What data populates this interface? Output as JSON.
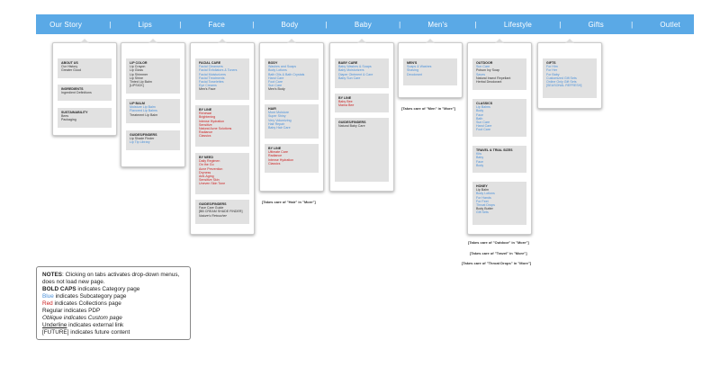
{
  "nav": [
    "Our Story",
    "Lips",
    "Face",
    "Body",
    "Baby",
    "Men's",
    "Lifestyle",
    "Gifts",
    "Outlet"
  ],
  "separator": "|",
  "columns": {
    "our_story": {
      "boxes": [
        {
          "title": "ABOUT US",
          "lines": [
            {
              "t": "Our History",
              "s": "plain"
            },
            {
              "t": "Greater Good",
              "s": "plain"
            }
          ]
        },
        {
          "title": "INGREDIENTS",
          "lines": [
            {
              "t": "Ingredient Definitions",
              "s": "plain"
            }
          ]
        },
        {
          "title": "SUSTAINABILITY",
          "lines": [
            {
              "t": "Bees",
              "s": "plain"
            },
            {
              "t": "Packaging",
              "s": "plain"
            }
          ]
        }
      ]
    },
    "lips": {
      "boxes": [
        {
          "title": "LIP COLOR",
          "lines": [
            {
              "t": "Lip Crayon",
              "s": "plain"
            },
            {
              "t": "Lip Gloss",
              "s": "plain"
            },
            {
              "t": "Lip Shimmer",
              "s": "plain"
            },
            {
              "t": "Lip Shine",
              "s": "plain"
            },
            {
              "t": "Tinted Lip Balm",
              "s": "plain"
            },
            {
              "t": "[LIPSICK]",
              "s": "plain"
            }
          ]
        },
        {
          "title": "LIP BALM",
          "lines": [
            {
              "t": "Moisture Lip Balm",
              "s": "sub"
            },
            {
              "t": "Flavored Lip Balms",
              "s": "sub"
            },
            {
              "t": "Treatment Lip Balm",
              "s": "plain"
            }
          ]
        },
        {
          "title": "GUIDES/FINDERS",
          "lines": [
            {
              "t": "Lip Shade Finder",
              "s": "plain"
            },
            {
              "t": "Lip Tip Library",
              "s": "sub"
            }
          ]
        }
      ]
    },
    "face": {
      "boxes": [
        {
          "title": "FACIAL CARE",
          "lines": [
            {
              "t": "Facial Cleansers",
              "s": "sub"
            },
            {
              "t": "Facial Exfoliators & Toners",
              "s": "sub"
            },
            {
              "t": "Facial Moisturizers",
              "s": "sub"
            },
            {
              "t": "Facial Treatments",
              "s": "sub"
            },
            {
              "t": "Facial Towelettes",
              "s": "sub"
            },
            {
              "t": "Eye Creams",
              "s": "sub"
            },
            {
              "t": "Men's Face",
              "s": "plain"
            }
          ]
        },
        {
          "title": "BY LINE",
          "lines": [
            {
              "t": "Renewal",
              "s": "coll"
            },
            {
              "t": "Brightening",
              "s": "coll"
            },
            {
              "t": "Intense Hydration",
              "s": "coll"
            },
            {
              "t": "Sensitive",
              "s": "coll"
            },
            {
              "t": "Natural Acne Solutions",
              "s": "coll"
            },
            {
              "t": "Radiance",
              "s": "coll"
            },
            {
              "t": "Classics",
              "s": "coll"
            }
          ]
        },
        {
          "title": "BY NEED",
          "lines": [
            {
              "t": "Daily Regimen",
              "s": "coll"
            },
            {
              "t": "On the Go",
              "s": "coll"
            },
            {
              "t": "Acne Prevention",
              "s": "coll"
            },
            {
              "t": "Dryness",
              "s": "coll"
            },
            {
              "t": "Anti-Aging",
              "s": "coll"
            },
            {
              "t": "Sensitive Skin",
              "s": "coll"
            },
            {
              "t": "Uneven Skin Tone",
              "s": "coll"
            }
          ]
        },
        {
          "title": "GUIDES/FINDERS",
          "lines": [
            {
              "t": "Face Care Guide",
              "s": "plain"
            },
            {
              "t": "[BB CREAM SHADE FINDER]",
              "s": "plain"
            },
            {
              "t": "Nature's Retoucher",
              "s": "ital"
            }
          ]
        }
      ]
    },
    "body": {
      "boxes": [
        {
          "title": "BODY",
          "lines": [
            {
              "t": "Washes and Soaps",
              "s": "sub"
            },
            {
              "t": "Body Lotions",
              "s": "sub"
            },
            {
              "t": "Bath Oils & Bath Crystals",
              "s": "sub"
            },
            {
              "t": "Hand Care",
              "s": "sub"
            },
            {
              "t": "Foot Care",
              "s": "sub"
            },
            {
              "t": "Sun Care",
              "s": "sub"
            },
            {
              "t": "Men's Body",
              "s": "plain"
            }
          ]
        },
        {
          "title": "HAIR",
          "lines": [
            {
              "t": "More Moisture",
              "s": "sub"
            },
            {
              "t": "Super Shiny",
              "s": "sub"
            },
            {
              "t": "Very Volumizing",
              "s": "sub"
            },
            {
              "t": "Hair Repair",
              "s": "sub"
            },
            {
              "t": "Baby Hair Care",
              "s": "sub"
            }
          ]
        },
        {
          "title": "BY LINE",
          "lines": [
            {
              "t": "Ultimate Care",
              "s": "coll"
            },
            {
              "t": "Radiance",
              "s": "coll"
            },
            {
              "t": "Intense Hydration",
              "s": "coll"
            },
            {
              "t": "Classics",
              "s": "coll"
            }
          ]
        }
      ],
      "note": "[Takes care of \"Hair\" in \"More\"]"
    },
    "baby": {
      "boxes": [
        {
          "title": "BABY CARE",
          "lines": [
            {
              "t": "Baby Washes & Soaps",
              "s": "sub"
            },
            {
              "t": "Baby Moisturizers",
              "s": "sub"
            },
            {
              "t": "Diaper Ointment & Care",
              "s": "sub"
            },
            {
              "t": "Baby Sun Care",
              "s": "sub"
            }
          ]
        },
        {
          "title": "BY LINE",
          "lines": [
            {
              "t": "Baby Bee",
              "s": "coll"
            },
            {
              "t": "Mama Bee",
              "s": "coll"
            }
          ]
        },
        {
          "title": "GUIDES/FINDERS",
          "lines": [
            {
              "t": "Natural Baby Care",
              "s": "plain"
            }
          ]
        }
      ]
    },
    "mens": {
      "boxes": [
        {
          "title": "MEN'S",
          "lines": [
            {
              "t": "Soaps & Washes",
              "s": "sub"
            },
            {
              "t": "Shaving",
              "s": "sub"
            },
            {
              "t": "Deodorant",
              "s": "sub"
            }
          ]
        }
      ],
      "note": "[Takes care of \"Men\" in \"More\"]"
    },
    "lifestyle": {
      "boxes": [
        {
          "title": "OUTDOOR",
          "lines": [
            {
              "t": "Sun Care",
              "s": "sub"
            },
            {
              "t": "Poison Ivy Soap",
              "s": "plain"
            },
            {
              "t": "Saves",
              "s": "sub"
            },
            {
              "t": "Natural Insect Repellant",
              "s": "plain"
            },
            {
              "t": "Herbal Deodorant",
              "s": "plain"
            }
          ]
        },
        {
          "title": "CLASSICS",
          "lines": [
            {
              "t": "Lip Balms",
              "s": "sub"
            },
            {
              "t": "Body",
              "s": "sub"
            },
            {
              "t": "Face",
              "s": "sub"
            },
            {
              "t": "Bath",
              "s": "sub"
            },
            {
              "t": "Sun Care",
              "s": "sub"
            },
            {
              "t": "Hand Care",
              "s": "sub"
            },
            {
              "t": "Foot Care",
              "s": "sub"
            }
          ]
        },
        {
          "title": "TRAVEL & TRIAL SIZES",
          "lines": [
            {
              "t": "Kits",
              "s": "sub"
            },
            {
              "t": "Baby",
              "s": "sub"
            },
            {
              "t": "Face",
              "s": "sub"
            },
            {
              "t": "Body",
              "s": "sub"
            }
          ]
        },
        {
          "title": "HONEY",
          "lines": [
            {
              "t": "Lip Balm",
              "s": "plain"
            },
            {
              "t": "Body Lotions",
              "s": "sub"
            },
            {
              "t": "For Hands",
              "s": "sub"
            },
            {
              "t": "For Feet",
              "s": "sub"
            },
            {
              "t": "Throat Drops",
              "s": "sub"
            },
            {
              "t": "Body Butter",
              "s": "plain"
            },
            {
              "t": "Gift Sets",
              "s": "sub"
            }
          ]
        }
      ],
      "notes": [
        "[Takes care of \"Outdoor\" in \"More\"]",
        "[Takes care of \"Travel\" in \"More\"]",
        "[Takes care of \"Throat Drops\" in \"More\"]"
      ]
    },
    "gifts": {
      "boxes": [
        {
          "title": "GIFTS",
          "lines": [
            {
              "t": "For Him",
              "s": "sub"
            },
            {
              "t": "For Her",
              "s": "sub"
            },
            {
              "t": "For Baby",
              "s": "sub"
            },
            {
              "t": "Customized Gift Sets",
              "s": "sub"
            },
            {
              "t": "Online Only Gift Sets",
              "s": "sub"
            },
            {
              "t": "[SEASONAL REFRESH]",
              "s": "sub"
            }
          ]
        }
      ]
    }
  },
  "legend": {
    "notes_label": "NOTES",
    "notes_text": ": Clicking on tabs activates drop-down menus, does not load new page.",
    "bold_caps": "BOLD CAPS",
    "bold_caps_text": " indicates Category page",
    "blue": "Blue",
    "blue_text": " indicates Subcategory page",
    "red": "Red",
    "red_text": " indicates Collections page",
    "regular": "Regular indicates PDP",
    "oblique": "Oblique indicates Custom page",
    "underline": "Underline",
    "underline_text": " indicates external link",
    "future": "[FUTURE] indicates future content"
  }
}
